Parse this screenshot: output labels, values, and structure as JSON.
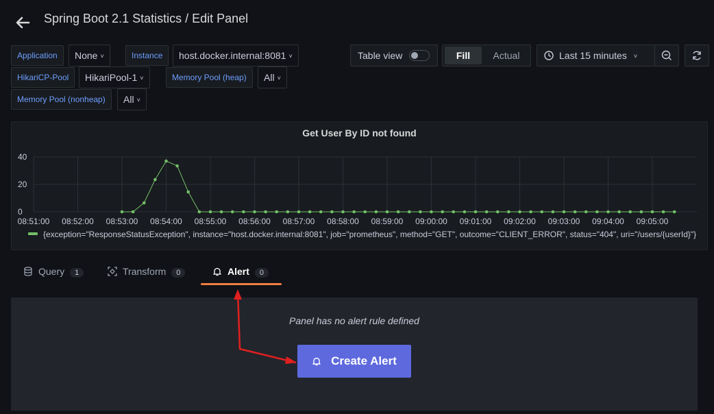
{
  "header": {
    "title": "Spring Boot 2.1 Statistics / Edit Panel"
  },
  "variables": [
    {
      "label": "Application",
      "value": "None"
    },
    {
      "label": "Instance",
      "value": "host.docker.internal:8081"
    },
    {
      "label": "HikariCP-Pool",
      "value": "HikariPool-1"
    },
    {
      "label": "Memory Pool (heap)",
      "value": "All"
    },
    {
      "label": "Memory Pool (nonheap)",
      "value": "All"
    }
  ],
  "toolbar": {
    "table_view_label": "Table view",
    "table_view_on": false,
    "fill_label": "Fill",
    "actual_label": "Actual",
    "time_range": "Last 15 minutes"
  },
  "panel": {
    "title": "Get User By ID not found"
  },
  "chart_data": {
    "type": "line",
    "title": "Get User By ID not found",
    "x_ticks": [
      "08:51:00",
      "08:52:00",
      "08:53:00",
      "08:54:00",
      "08:55:00",
      "08:56:00",
      "08:57:00",
      "08:58:00",
      "08:59:00",
      "09:00:00",
      "09:01:00",
      "09:02:00",
      "09:03:00",
      "09:04:00",
      "09:05:00"
    ],
    "y_ticks": [
      "0",
      "20",
      "40"
    ],
    "ylim": [
      0,
      45
    ],
    "grid": true,
    "legend": "bottom-left",
    "x": [
      "08:53:00",
      "08:53:15",
      "08:53:30",
      "08:53:45",
      "08:54:00",
      "08:54:15",
      "08:54:30",
      "08:54:45",
      "08:55:00",
      "08:55:15",
      "08:55:30",
      "08:55:45",
      "08:56:00",
      "08:56:15",
      "08:56:30",
      "08:56:45",
      "08:57:00",
      "08:57:15",
      "08:57:30",
      "08:57:45",
      "08:58:00",
      "08:58:15",
      "08:58:30",
      "08:58:45",
      "08:59:00",
      "08:59:15",
      "08:59:30",
      "08:59:45",
      "09:00:00",
      "09:00:15",
      "09:00:30",
      "09:00:45",
      "09:01:00",
      "09:01:15",
      "09:01:30",
      "09:01:45",
      "09:02:00",
      "09:02:15",
      "09:02:30",
      "09:02:45",
      "09:03:00",
      "09:03:15",
      "09:03:30",
      "09:03:45",
      "09:04:00",
      "09:04:15",
      "09:04:30",
      "09:04:45",
      "09:05:00",
      "09:05:15",
      "09:05:30"
    ],
    "series": [
      {
        "name": "{exception=\"ResponseStatusException\", instance=\"host.docker.internal:8081\", job=\"prometheus\", method=\"GET\", outcome=\"CLIENT_ERROR\", status=\"404\", uri=\"/users/{userId}\"}",
        "color": "#73bf69",
        "values": [
          0,
          0,
          6.5,
          23.5,
          37,
          33.5,
          14.5,
          0,
          0,
          0,
          0,
          0,
          0,
          0,
          0,
          0,
          0,
          0,
          0,
          0,
          0,
          0,
          0,
          0,
          0,
          0,
          0,
          0,
          0,
          0,
          0,
          0,
          0,
          0,
          0,
          0,
          0,
          0,
          0,
          0,
          0,
          0,
          0,
          0,
          0,
          0,
          0,
          0,
          0,
          0,
          0
        ]
      }
    ]
  },
  "tabs": [
    {
      "label": "Query",
      "count": "1",
      "icon": "database-icon"
    },
    {
      "label": "Transform",
      "count": "0",
      "icon": "transform-icon"
    },
    {
      "label": "Alert",
      "count": "0",
      "icon": "bell-icon",
      "active": true
    }
  ],
  "alert": {
    "empty_text": "Panel has no alert rule defined",
    "create_label": "Create Alert"
  },
  "colors": {
    "accent": "#5d69dd",
    "series": "#73bf69",
    "tab_active": "#f07e3f",
    "annotation_arrow": "#e02020"
  }
}
